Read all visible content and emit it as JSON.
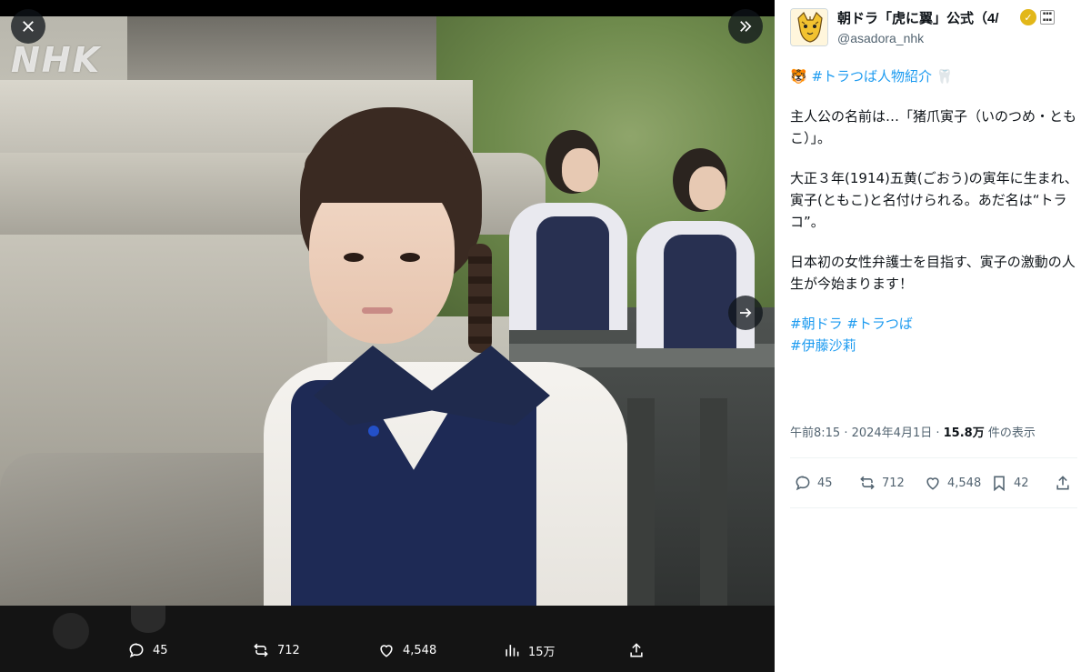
{
  "viewer": {
    "watermark": "NHK",
    "close_icon": "close-icon",
    "expand_icon": "expand-panel-icon",
    "next_icon": "arrow-right-icon",
    "actions": {
      "replies": "45",
      "reposts": "712",
      "likes": "4,548",
      "views": "15万"
    }
  },
  "post": {
    "author_name": "朝ドラ「虎に翼」公式（4/",
    "author_handle": "@asadora_nhk",
    "verified_color": "#e2b719",
    "lines": {
      "hashtag_intro_emoji": "🐯",
      "hashtag_intro": "#トラつば人物紹介",
      "hashtag_intro_emoji2": "🦷",
      "p1": "主人公の名前は…「猪爪寅子（いのつめ・ともこ）」。",
      "p2": "大正３年(1914)五黄(ごおう)の寅年に生まれ、寅子(ともこ)と名付けられる。あだ名は“トラコ”。",
      "p3": "日本初の女性弁護士を目指す、寅子の激動の人生が今始まります！",
      "tag1": "#朝ドラ",
      "tag2": "#トラつば",
      "tag3": "#伊藤沙莉"
    },
    "meta": {
      "time": "午前8:15 · 2024年4月1日 · ",
      "views_count": "15.8万",
      "views_suffix": " 件の表示"
    },
    "actions": {
      "replies": "45",
      "reposts": "712",
      "likes": "4,548",
      "bookmarks": "42"
    }
  }
}
